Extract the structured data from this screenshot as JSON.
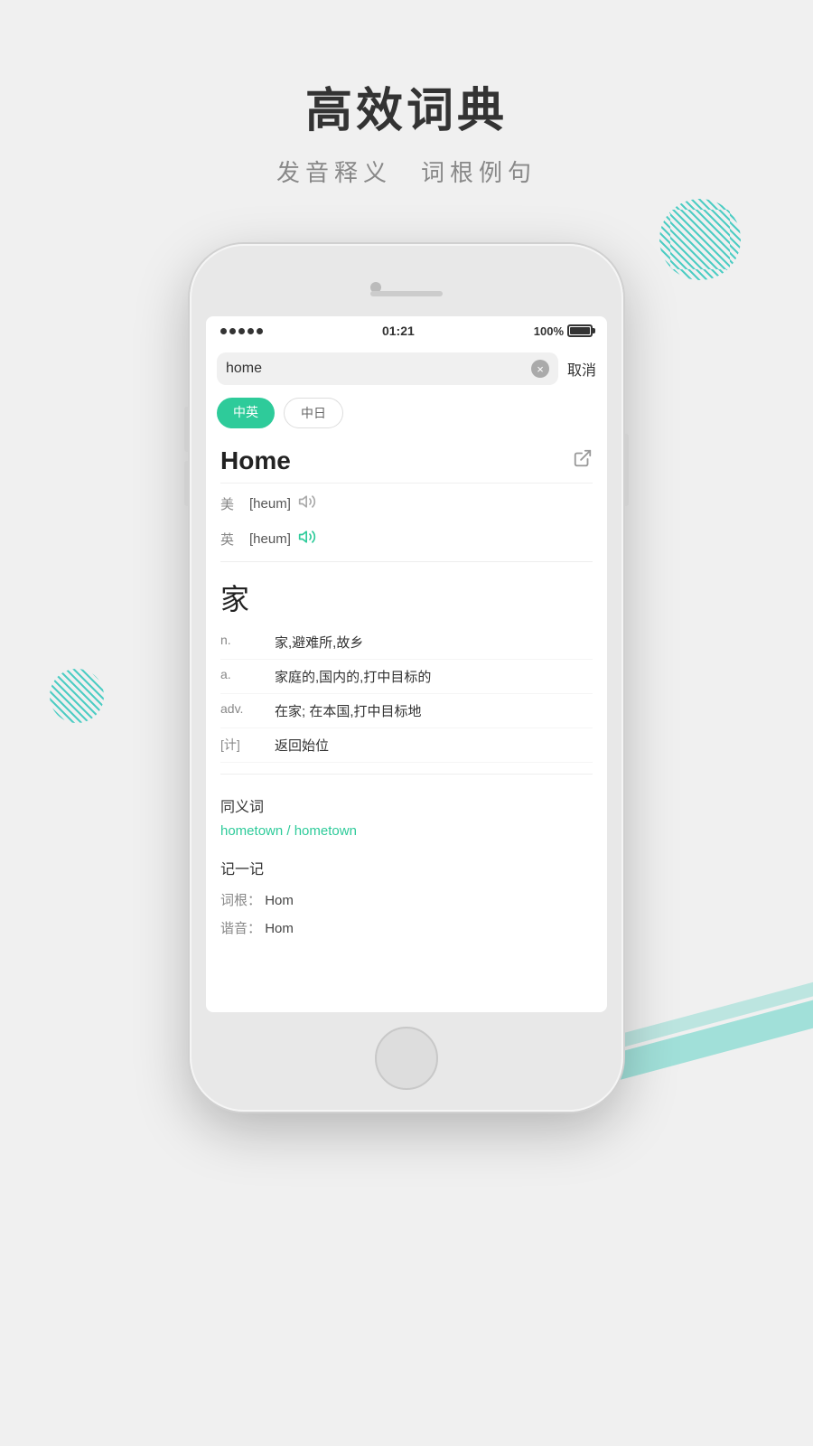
{
  "header": {
    "title": "高效词典",
    "subtitle": "发音释义　词根例句"
  },
  "status_bar": {
    "signal": "•••••",
    "time": "01:21",
    "battery": "100%"
  },
  "search": {
    "value": "home",
    "cancel_label": "取消",
    "clear_title": "×"
  },
  "language_tabs": [
    {
      "label": "中英",
      "active": true
    },
    {
      "label": "中日",
      "active": false
    }
  ],
  "dictionary": {
    "word": "Home",
    "share_icon": "⬡",
    "pronunciation": [
      {
        "region": "美",
        "ipa": "[heum]",
        "has_audio": false
      },
      {
        "region": "英",
        "ipa": "[heum]",
        "has_audio": true
      }
    ],
    "chinese_char": "家",
    "definitions": [
      {
        "type": "n.",
        "text": "家,避难所,故乡"
      },
      {
        "type": "a.",
        "text": "家庭的,国内的,打中目标的"
      },
      {
        "type": "adv.",
        "text": "在家; 在本国,打中目标地"
      },
      {
        "type": "[计]",
        "text": "返回始位"
      }
    ],
    "synonyms_title": "同义词",
    "synonyms": "hometown / hometown",
    "memory_title": "记一记",
    "memory_items": [
      {
        "label": "词根：",
        "value": "Hom"
      },
      {
        "label": "谐音：",
        "value": "Hom"
      }
    ]
  }
}
